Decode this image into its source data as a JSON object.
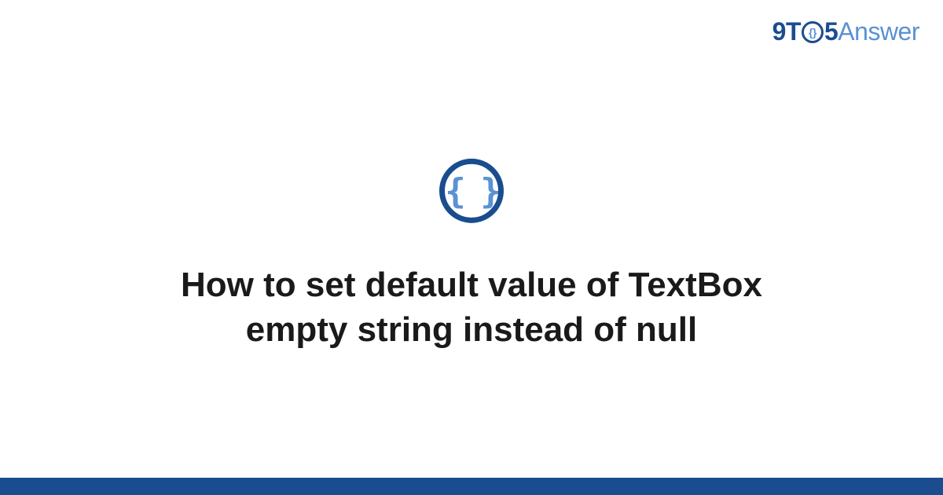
{
  "logo": {
    "part1": "9T",
    "clock": "{}",
    "part2": "5",
    "part3": "Answer"
  },
  "icon": {
    "braces": "{ }"
  },
  "title": "How to set default value of TextBox empty string instead of null"
}
